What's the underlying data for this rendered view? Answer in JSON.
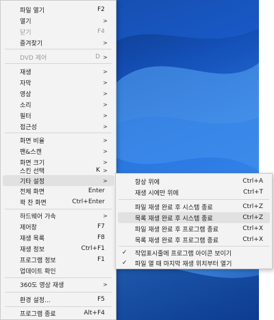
{
  "main_menu": {
    "items": [
      {
        "label": "파일 열기",
        "shortcut": "F2"
      },
      {
        "label": "열기",
        "shortcut": ""
      },
      {
        "label": "닫기",
        "shortcut": "F4"
      },
      {
        "label": "즐겨찾기",
        "shortcut": ""
      },
      {
        "label": "DVD 제어",
        "shortcut": "D"
      },
      {
        "label": "재생",
        "shortcut": ""
      },
      {
        "label": "자막",
        "shortcut": ""
      },
      {
        "label": "영상",
        "shortcut": ""
      },
      {
        "label": "소리",
        "shortcut": ""
      },
      {
        "label": "필터",
        "shortcut": ""
      },
      {
        "label": "접근성",
        "shortcut": ""
      },
      {
        "label": "화면 비율",
        "shortcut": ""
      },
      {
        "label": "팬&스캔",
        "shortcut": ""
      },
      {
        "label": "화면 크기",
        "shortcut": ""
      },
      {
        "label": "스킨 선택",
        "shortcut": "K"
      },
      {
        "label": "기타 설정",
        "shortcut": ""
      },
      {
        "label": "전체 화면",
        "shortcut": "Enter"
      },
      {
        "label": "꽉 찬 화면",
        "shortcut": "Ctrl+Enter"
      },
      {
        "label": "하드웨어 가속",
        "shortcut": ""
      },
      {
        "label": "제어창",
        "shortcut": "F7"
      },
      {
        "label": "재생 목록",
        "shortcut": "F8"
      },
      {
        "label": "재생 정보",
        "shortcut": "Ctrl+F1"
      },
      {
        "label": "프로그램 정보",
        "shortcut": "F1"
      },
      {
        "label": "업데이트 확인",
        "shortcut": ""
      },
      {
        "label": "360도 영상 재생",
        "shortcut": ""
      },
      {
        "label": "환경 설정...",
        "shortcut": "F5"
      },
      {
        "label": "프로그램 종료",
        "shortcut": "Alt+F4"
      }
    ]
  },
  "submenu": {
    "items": [
      {
        "label": "항상 위에",
        "shortcut": "Ctrl+A"
      },
      {
        "label": "재생 시에만 위에",
        "shortcut": "Ctrl+T"
      },
      {
        "label": "파일 재생 완료 후 시스템 종료",
        "shortcut": "Ctrl+Z"
      },
      {
        "label": "목록 재생 완료 후 시스템 종료",
        "shortcut": "Ctrl+Z"
      },
      {
        "label": "파일 재생 완료 후 프로그램 종료",
        "shortcut": "Ctrl+X"
      },
      {
        "label": "목록 재생 완료 후 프로그램 종료",
        "shortcut": "Ctrl+X"
      },
      {
        "label": "작업표시줄에 프로그램 아이콘 보이기",
        "shortcut": ""
      },
      {
        "label": "파일 열 때 마지막 재생 위치부터 열기",
        "shortcut": ""
      }
    ]
  },
  "icons": {
    "submenu_arrow": "chevron-right-icon",
    "check": "check-icon"
  },
  "colors": {
    "highlight": "#e1e1e1",
    "disabled_text": "#9a9a9a",
    "menu_bg": "#f3f3f3"
  }
}
